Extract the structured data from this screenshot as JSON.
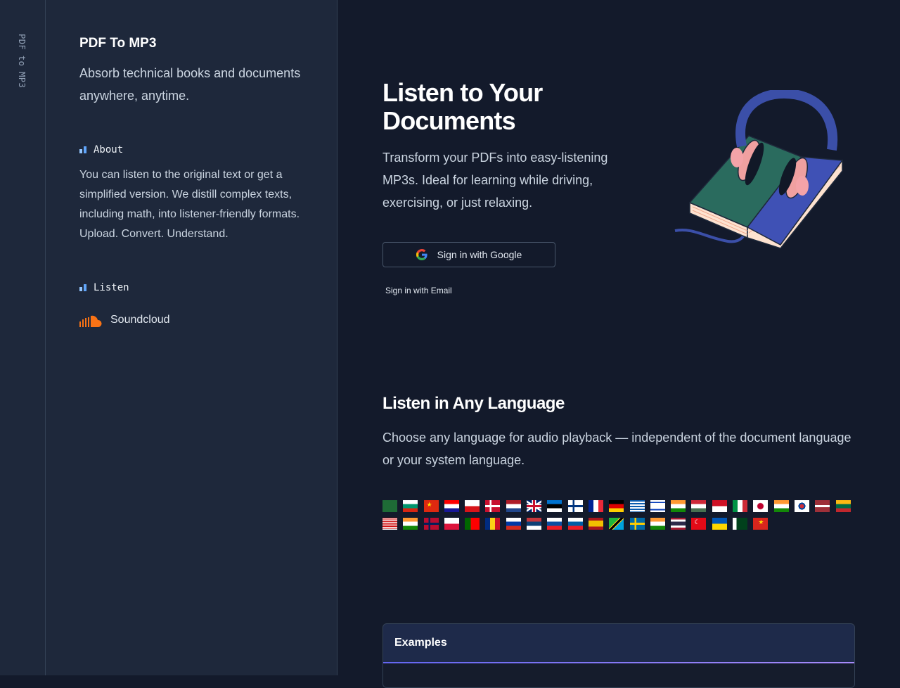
{
  "rail": {
    "title": "PDF to MP3"
  },
  "sidebar": {
    "app_name": "PDF To MP3",
    "tagline": "Absorb technical books and documents anywhere, anytime.",
    "about": {
      "heading": "About",
      "text": "You can listen to the original text or get a simplified version. We distill complex texts, including math, into listener-friendly formats. Upload. Convert. Understand."
    },
    "listen": {
      "heading": "Listen",
      "soundcloud_label": "Soundcloud"
    }
  },
  "hero": {
    "title": "Listen to Your Documents",
    "text": "Transform your PDFs into easy-listening MP3s. Ideal for learning while driving, exercising, or just relaxing.",
    "google_button": "Sign in with Google",
    "email_link": "Sign in with Email"
  },
  "languages": {
    "title": "Listen in Any Language",
    "text": "Choose any language for audio playback — independent of the document language or your system language.",
    "flags": [
      "sa",
      "bg",
      "cn",
      "hr",
      "cz",
      "dk",
      "nl",
      "gb",
      "ee",
      "fi",
      "fr",
      "de",
      "gr",
      "il",
      "in",
      "hu",
      "id",
      "it",
      "jp",
      "in",
      "kr",
      "lv",
      "lt",
      "my",
      "in",
      "no",
      "pl",
      "pt",
      "ro",
      "ru",
      "rs",
      "sk",
      "si",
      "es",
      "tz",
      "se",
      "in",
      "th",
      "tr",
      "ua",
      "pk",
      "vn"
    ]
  },
  "examples": {
    "title": "Examples"
  },
  "colors": {
    "background": "#131a2b",
    "sidebar": "#1e283b",
    "accent": "#60a5fa",
    "soundcloud": "#f97316"
  }
}
